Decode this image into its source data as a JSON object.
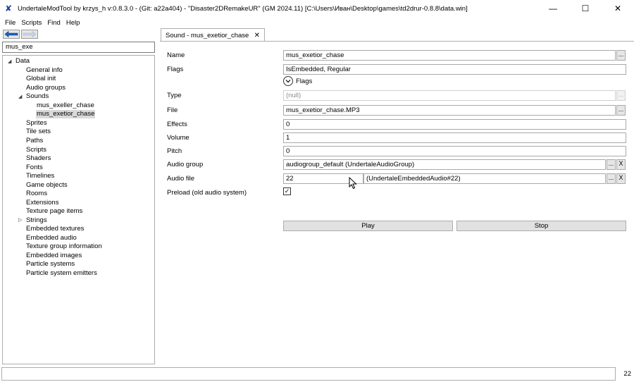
{
  "window": {
    "title": "UndertaleModTool by krzys_h v:0.8.3.0 - (Git: a22a404) - \"Disaster2DRemakeUR\" (GM 2024.11) [C:\\Users\\Иван\\Desktop\\games\\td2drur-0.8.8\\data.win]",
    "minimize": "—",
    "maximize": "☐",
    "close": "✕"
  },
  "menu": [
    "File",
    "Scripts",
    "Find",
    "Help"
  ],
  "search": {
    "value": "mus_exe"
  },
  "tree": {
    "root": "Data",
    "items": [
      "General info",
      "Global init",
      "Audio groups",
      "Sounds",
      "mus_exeller_chase",
      "mus_exetior_chase",
      "Sprites",
      "Tile sets",
      "Paths",
      "Scripts",
      "Shaders",
      "Fonts",
      "Timelines",
      "Game objects",
      "Rooms",
      "Extensions",
      "Texture page items",
      "Strings",
      "Embedded textures",
      "Embedded audio",
      "Texture group information",
      "Embedded images",
      "Particle systems",
      "Particle system emitters"
    ]
  },
  "tab": {
    "label": "Sound - mus_exetior_chase",
    "close": "✕"
  },
  "form": {
    "name_label": "Name",
    "name_value": "mus_exetior_chase",
    "flags_label": "Flags",
    "flags_value": "IsEmbedded, Regular",
    "flags_toggle": "Flags",
    "type_label": "Type",
    "type_value": "(null)",
    "file_label": "File",
    "file_value": "mus_exetior_chase.MP3",
    "effects_label": "Effects",
    "effects_value": "0",
    "volume_label": "Volume",
    "volume_value": "1",
    "pitch_label": "Pitch",
    "pitch_value": "0",
    "audio_group_label": "Audio group",
    "audio_group_value": "audiogroup_default (UndertaleAudioGroup)",
    "audio_file_label": "Audio file",
    "audio_file_id": "22",
    "audio_file_value": "(UndertaleEmbeddedAudio#22)",
    "preload_label": "Preload (old audio system)",
    "preload_checked": "✓",
    "browse": "...",
    "clear": "X",
    "play": "Play",
    "stop": "Stop"
  },
  "status": {
    "count": "22"
  }
}
